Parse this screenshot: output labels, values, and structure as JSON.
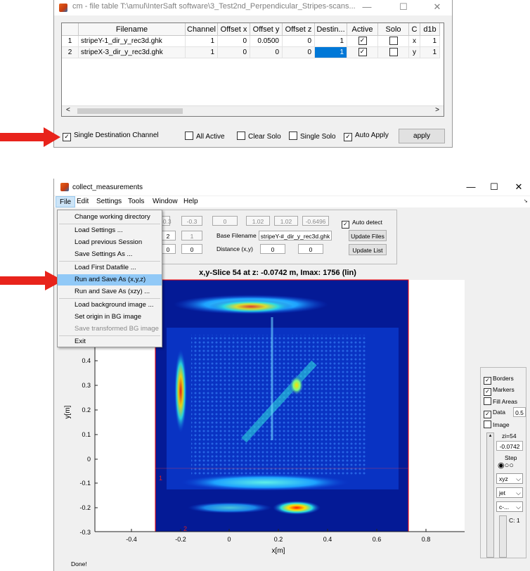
{
  "file_table_window": {
    "title": "cm - file table T:\\amul\\InterSaft software\\3_Test2nd_Perpendicular_Stripes-scans...",
    "controls": {
      "minimize": "—",
      "maximize": "☐",
      "close": "✕"
    },
    "columns": [
      "Filename",
      "Channel",
      "Offset x",
      "Offset y",
      "Offset z",
      "Destin...",
      "Active",
      "Solo",
      "C",
      "d1b"
    ],
    "rows": [
      {
        "index": "1",
        "filename": "stripeY-1_dir_y_rec3d.ghk",
        "channel": "1",
        "offset_x": "0",
        "offset_y": "0.0500",
        "offset_z": "0",
        "destin": "1",
        "active": true,
        "solo": false,
        "c": "x",
        "d1b": "1"
      },
      {
        "index": "2",
        "filename": "stripeX-3_dir_y_rec3d.ghk",
        "channel": "1",
        "offset_x": "0",
        "offset_y": "0",
        "offset_z": "0",
        "destin": "1",
        "active": true,
        "solo": false,
        "c": "y",
        "d1b": "1"
      }
    ],
    "options": {
      "single_destination_channel": "Single Destination Channel",
      "all_active": "All Active",
      "clear_solo": "Clear Solo",
      "single_solo": "Single Solo",
      "auto_apply": "Auto Apply"
    },
    "apply_label": "apply"
  },
  "collect_window": {
    "title": "collect_measurements",
    "controls": {
      "minimize": "—",
      "maximize": "☐",
      "close": "✕"
    },
    "menu": [
      "File",
      "Edit",
      "Settings",
      "Tools",
      "Window",
      "Help"
    ],
    "file_menu": {
      "items": [
        {
          "label": "Change working directory",
          "enabled": true
        },
        {
          "label": "Load Settings ...",
          "enabled": true
        },
        {
          "label": "Load previous Session",
          "enabled": true
        },
        {
          "label": "Save Settings As ...",
          "enabled": true
        },
        {
          "label": "Load First Datafile ...",
          "enabled": true
        },
        {
          "label": "Run and Save As (x,y,z)",
          "enabled": true,
          "highlighted": true
        },
        {
          "label": "Run and Save As (xzy) ...",
          "enabled": true
        },
        {
          "label": "Load background image ...",
          "enabled": true
        },
        {
          "label": "Set origin in BG image",
          "enabled": true
        },
        {
          "label": "Save transformed BG image",
          "enabled": false
        },
        {
          "label": "Exit",
          "enabled": true
        }
      ]
    },
    "params": {
      "row1": [
        "-0.3",
        "-0.3",
        "0",
        "1.02",
        "1.02",
        "-0.6496"
      ],
      "row2": [
        "2",
        "1"
      ],
      "row3": [
        "0",
        "0"
      ],
      "base_filename_label": "Base Filename",
      "base_filename_value": "stripeY-#_dir_y_rec3d.ghk",
      "distance_label": "Distance (x,y)",
      "distance_values": [
        "0",
        "0"
      ],
      "auto_detect_label": "Auto detect",
      "update_files_label": "Update Files",
      "update_list_label": "Update List"
    },
    "plot": {
      "title": "x,y-Slice 54 at z: -0.0742 m, Imax: 1756 (lin)",
      "xlabel": "x[m]",
      "ylabel": "y[m]",
      "x_ticks": [
        "-0.4",
        "-0.2",
        "0",
        "0.2",
        "0.4",
        "0.6",
        "0.8"
      ],
      "y_ticks": [
        "0.4",
        "0.3",
        "0.2",
        "0.1",
        "0",
        "-0.1",
        "-0.2",
        "-0.3"
      ],
      "marker1": "1",
      "marker2": "2"
    },
    "right_panel": {
      "borders": "Borders",
      "markers": "Markers",
      "fill_areas": "Fill Areas",
      "data": "Data",
      "data_value": "0.5",
      "image": "Image",
      "zi_label": "zi=54",
      "zi_value": "-0.0742",
      "step_label": "Step",
      "view_select": "xyz",
      "colormap_select": "jet",
      "c_select": "c-...",
      "c_label": "C: 1"
    },
    "status": "Done!"
  },
  "colors": {
    "arrow": "#e8231b",
    "menu_highlight": "#91c9f7",
    "selection": "#0078d7"
  }
}
